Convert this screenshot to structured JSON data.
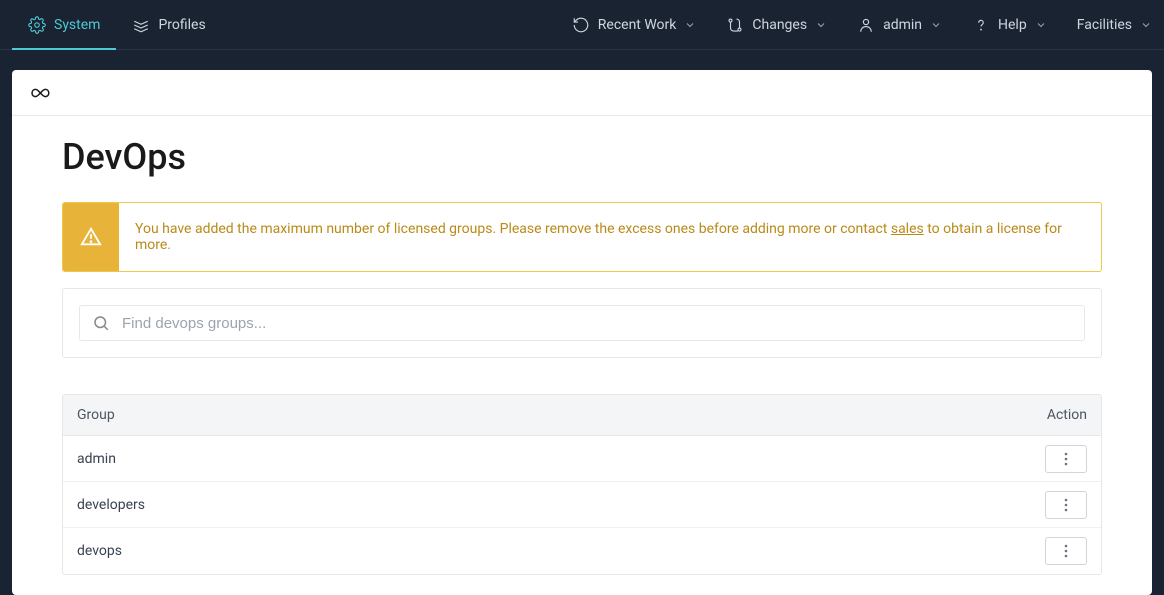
{
  "topbar": {
    "left": [
      {
        "label": "System",
        "active": true
      },
      {
        "label": "Profiles",
        "active": false
      }
    ],
    "right": {
      "recent_work": "Recent Work",
      "changes": "Changes",
      "admin": "admin",
      "help": "Help",
      "facilities": "Facilities"
    }
  },
  "page": {
    "title": "DevOps"
  },
  "warning": {
    "text_before": "You have added the maximum number of licensed groups. Please remove the excess ones before adding more or contact ",
    "link": "sales",
    "text_after": " to obtain a license for more."
  },
  "search": {
    "placeholder": "Find devops groups..."
  },
  "table": {
    "headers": {
      "group": "Group",
      "action": "Action"
    },
    "rows": [
      {
        "group": "admin"
      },
      {
        "group": "developers"
      },
      {
        "group": "devops"
      }
    ]
  }
}
